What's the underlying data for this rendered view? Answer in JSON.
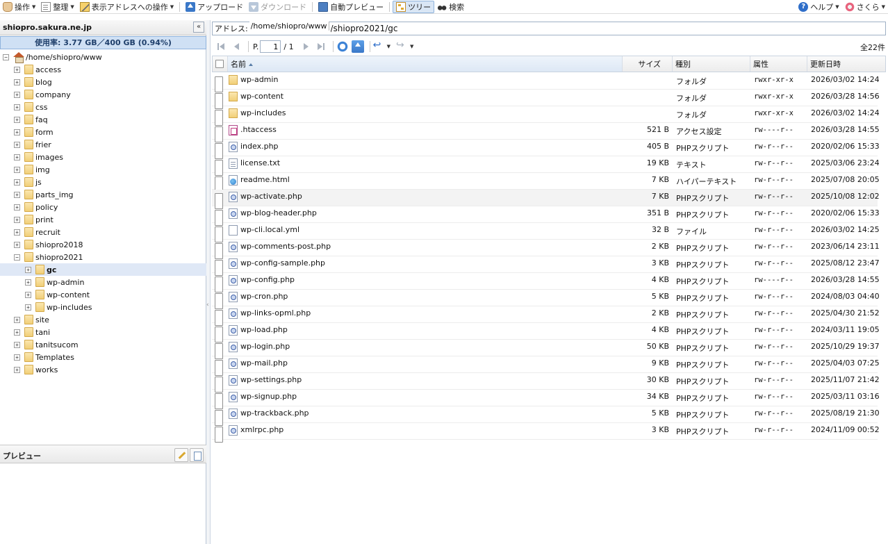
{
  "toolbar": {
    "operations": "操作",
    "organize": "整理",
    "address_ops": "表示アドレスへの操作",
    "upload": "アップロード",
    "download": "ダウンロード",
    "auto_preview": "自動プレビュー",
    "tree": "ツリー",
    "search": "検索",
    "help": "ヘルプ",
    "user": "さくら"
  },
  "left": {
    "host": "shiopro.sakura.ne.jp",
    "collapse": "«",
    "usage": "使用率: 3.77 GB／400 GB (0.94%)",
    "tree_root": "/home/shiopro/www",
    "tree_items": [
      {
        "label": "access",
        "level": 1,
        "expander": "+"
      },
      {
        "label": "blog",
        "level": 1,
        "expander": "+"
      },
      {
        "label": "company",
        "level": 1,
        "expander": "+"
      },
      {
        "label": "css",
        "level": 1,
        "expander": "+"
      },
      {
        "label": "faq",
        "level": 1,
        "expander": "+"
      },
      {
        "label": "form",
        "level": 1,
        "expander": "+"
      },
      {
        "label": "frier",
        "level": 1,
        "expander": "+"
      },
      {
        "label": "images",
        "level": 1,
        "expander": "+"
      },
      {
        "label": "img",
        "level": 1,
        "expander": "+"
      },
      {
        "label": "js",
        "level": 1,
        "expander": "+"
      },
      {
        "label": "parts_img",
        "level": 1,
        "expander": "+"
      },
      {
        "label": "policy",
        "level": 1,
        "expander": "+"
      },
      {
        "label": "print",
        "level": 1,
        "expander": "+"
      },
      {
        "label": "recruit",
        "level": 1,
        "expander": "+"
      },
      {
        "label": "shiopro2018",
        "level": 1,
        "expander": "+"
      },
      {
        "label": "shiopro2021",
        "level": 1,
        "expander": "−"
      },
      {
        "label": "gc",
        "level": 2,
        "expander": "+",
        "selected": true
      },
      {
        "label": "wp-admin",
        "level": 2,
        "expander": "+"
      },
      {
        "label": "wp-content",
        "level": 2,
        "expander": "+"
      },
      {
        "label": "wp-includes",
        "level": 2,
        "expander": "+"
      },
      {
        "label": "site",
        "level": 1,
        "expander": "+"
      },
      {
        "label": "tani",
        "level": 1,
        "expander": "+"
      },
      {
        "label": "tanitsucom",
        "level": 1,
        "expander": "+"
      },
      {
        "label": "Templates",
        "level": 1,
        "expander": "+"
      },
      {
        "label": "works",
        "level": 1,
        "expander": "+"
      }
    ],
    "preview_title": "プレビュー"
  },
  "address": {
    "label": "アドレス:",
    "root": "/home/shiopro/www",
    "path": "/shiopro2021/gc"
  },
  "pager": {
    "page_label": "P.",
    "page_value": "1",
    "page_total": "/ 1",
    "total": "全22件"
  },
  "columns": {
    "name": "名前",
    "size": "サイズ",
    "type": "種別",
    "attr": "属性",
    "date": "更新日時"
  },
  "files": [
    {
      "icon": "folder",
      "name": "wp-admin",
      "size": "",
      "type": "フォルダ",
      "attr": "rwxr-xr-x",
      "date": "2026/03/02 14:24"
    },
    {
      "icon": "folder",
      "name": "wp-content",
      "size": "",
      "type": "フォルダ",
      "attr": "rwxr-xr-x",
      "date": "2026/03/28 14:56"
    },
    {
      "icon": "folder",
      "name": "wp-includes",
      "size": "",
      "type": "フォルダ",
      "attr": "rwxr-xr-x",
      "date": "2026/03/02 14:24"
    },
    {
      "icon": "htaccess",
      "name": ".htaccess",
      "size": "521 B",
      "type": "アクセス設定",
      "attr": "rw----r--",
      "date": "2026/03/28 14:55"
    },
    {
      "icon": "php",
      "name": "index.php",
      "size": "405 B",
      "type": "PHPスクリプト",
      "attr": "rw-r--r--",
      "date": "2020/02/06 15:33"
    },
    {
      "icon": "text",
      "name": "license.txt",
      "size": "19 KB",
      "type": "テキスト",
      "attr": "rw-r--r--",
      "date": "2025/03/06 23:24"
    },
    {
      "icon": "html",
      "name": "readme.html",
      "size": "7 KB",
      "type": "ハイパーテキスト",
      "attr": "rw-r--r--",
      "date": "2025/07/08 20:05"
    },
    {
      "icon": "php",
      "name": "wp-activate.php",
      "size": "7 KB",
      "type": "PHPスクリプト",
      "attr": "rw-r--r--",
      "date": "2025/10/08 12:02",
      "highlight": true
    },
    {
      "icon": "php",
      "name": "wp-blog-header.php",
      "size": "351 B",
      "type": "PHPスクリプト",
      "attr": "rw-r--r--",
      "date": "2020/02/06 15:33"
    },
    {
      "icon": "plain",
      "name": "wp-cli.local.yml",
      "size": "32 B",
      "type": "ファイル",
      "attr": "rw-r--r--",
      "date": "2026/03/02 14:25"
    },
    {
      "icon": "php",
      "name": "wp-comments-post.php",
      "size": "2 KB",
      "type": "PHPスクリプト",
      "attr": "rw-r--r--",
      "date": "2023/06/14 23:11"
    },
    {
      "icon": "php",
      "name": "wp-config-sample.php",
      "size": "3 KB",
      "type": "PHPスクリプト",
      "attr": "rw-r--r--",
      "date": "2025/08/12 23:47"
    },
    {
      "icon": "php",
      "name": "wp-config.php",
      "size": "4 KB",
      "type": "PHPスクリプト",
      "attr": "rw----r--",
      "date": "2026/03/28 14:55"
    },
    {
      "icon": "php",
      "name": "wp-cron.php",
      "size": "5 KB",
      "type": "PHPスクリプト",
      "attr": "rw-r--r--",
      "date": "2024/08/03 04:40"
    },
    {
      "icon": "php",
      "name": "wp-links-opml.php",
      "size": "2 KB",
      "type": "PHPスクリプト",
      "attr": "rw-r--r--",
      "date": "2025/04/30 21:52"
    },
    {
      "icon": "php",
      "name": "wp-load.php",
      "size": "4 KB",
      "type": "PHPスクリプト",
      "attr": "rw-r--r--",
      "date": "2024/03/11 19:05"
    },
    {
      "icon": "php",
      "name": "wp-login.php",
      "size": "50 KB",
      "type": "PHPスクリプト",
      "attr": "rw-r--r--",
      "date": "2025/10/29 19:37"
    },
    {
      "icon": "php",
      "name": "wp-mail.php",
      "size": "9 KB",
      "type": "PHPスクリプト",
      "attr": "rw-r--r--",
      "date": "2025/04/03 07:25"
    },
    {
      "icon": "php",
      "name": "wp-settings.php",
      "size": "30 KB",
      "type": "PHPスクリプト",
      "attr": "rw-r--r--",
      "date": "2025/11/07 21:42"
    },
    {
      "icon": "php",
      "name": "wp-signup.php",
      "size": "34 KB",
      "type": "PHPスクリプト",
      "attr": "rw-r--r--",
      "date": "2025/03/11 03:16"
    },
    {
      "icon": "php",
      "name": "wp-trackback.php",
      "size": "5 KB",
      "type": "PHPスクリプト",
      "attr": "rw-r--r--",
      "date": "2025/08/19 21:30"
    },
    {
      "icon": "php",
      "name": "xmlrpc.php",
      "size": "3 KB",
      "type": "PHPスクリプト",
      "attr": "rw-r--r--",
      "date": "2024/11/09 00:52"
    }
  ]
}
